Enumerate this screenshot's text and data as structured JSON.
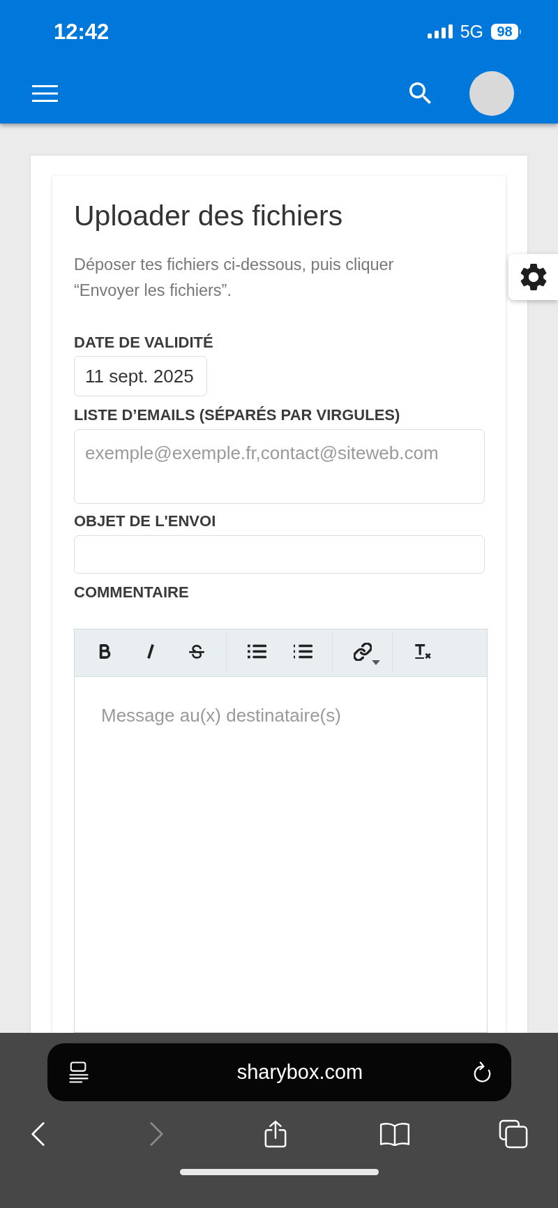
{
  "status_bar": {
    "time": "12:42",
    "network": "5G",
    "battery": "98"
  },
  "form": {
    "title": "Uploader des fichiers",
    "description": "Déposer tes fichiers ci-dessous, puis cliquer “Envoyer les fichiers”.",
    "fields": [
      {
        "kind": "date",
        "label": "DATE DE VALIDITÉ",
        "value": "11 sept. 2025"
      },
      {
        "kind": "textarea",
        "label": "LISTE D’EMAILS (SÉPARÉS PAR VIRGULES)",
        "placeholder": "exemple@exemple.fr,contact@siteweb.com"
      },
      {
        "kind": "text",
        "label": "OBJET DE L'ENVOI"
      },
      {
        "kind": "editor",
        "label": "COMMENTAIRE",
        "placeholder": "Message au(x) destinataire(s)",
        "toolbar_groups": [
          {
            "buttons": [
              {
                "kind": "bold"
              },
              {
                "kind": "italic"
              },
              {
                "kind": "strike"
              }
            ]
          },
          {
            "buttons": [
              {
                "kind": "bullet_list"
              },
              {
                "kind": "numbered_list"
              }
            ]
          },
          {
            "buttons": [
              {
                "kind": "link"
              }
            ]
          },
          {
            "buttons": [
              {
                "kind": "clear_format"
              }
            ]
          }
        ]
      }
    ]
  },
  "browser": {
    "url": "sharybox.com",
    "toolbar": [
      {
        "kind": "back",
        "disabled": false
      },
      {
        "kind": "forward",
        "disabled": true
      },
      {
        "kind": "share",
        "disabled": false
      },
      {
        "kind": "bookmarks",
        "disabled": false
      },
      {
        "kind": "tabs",
        "disabled": false
      }
    ]
  }
}
